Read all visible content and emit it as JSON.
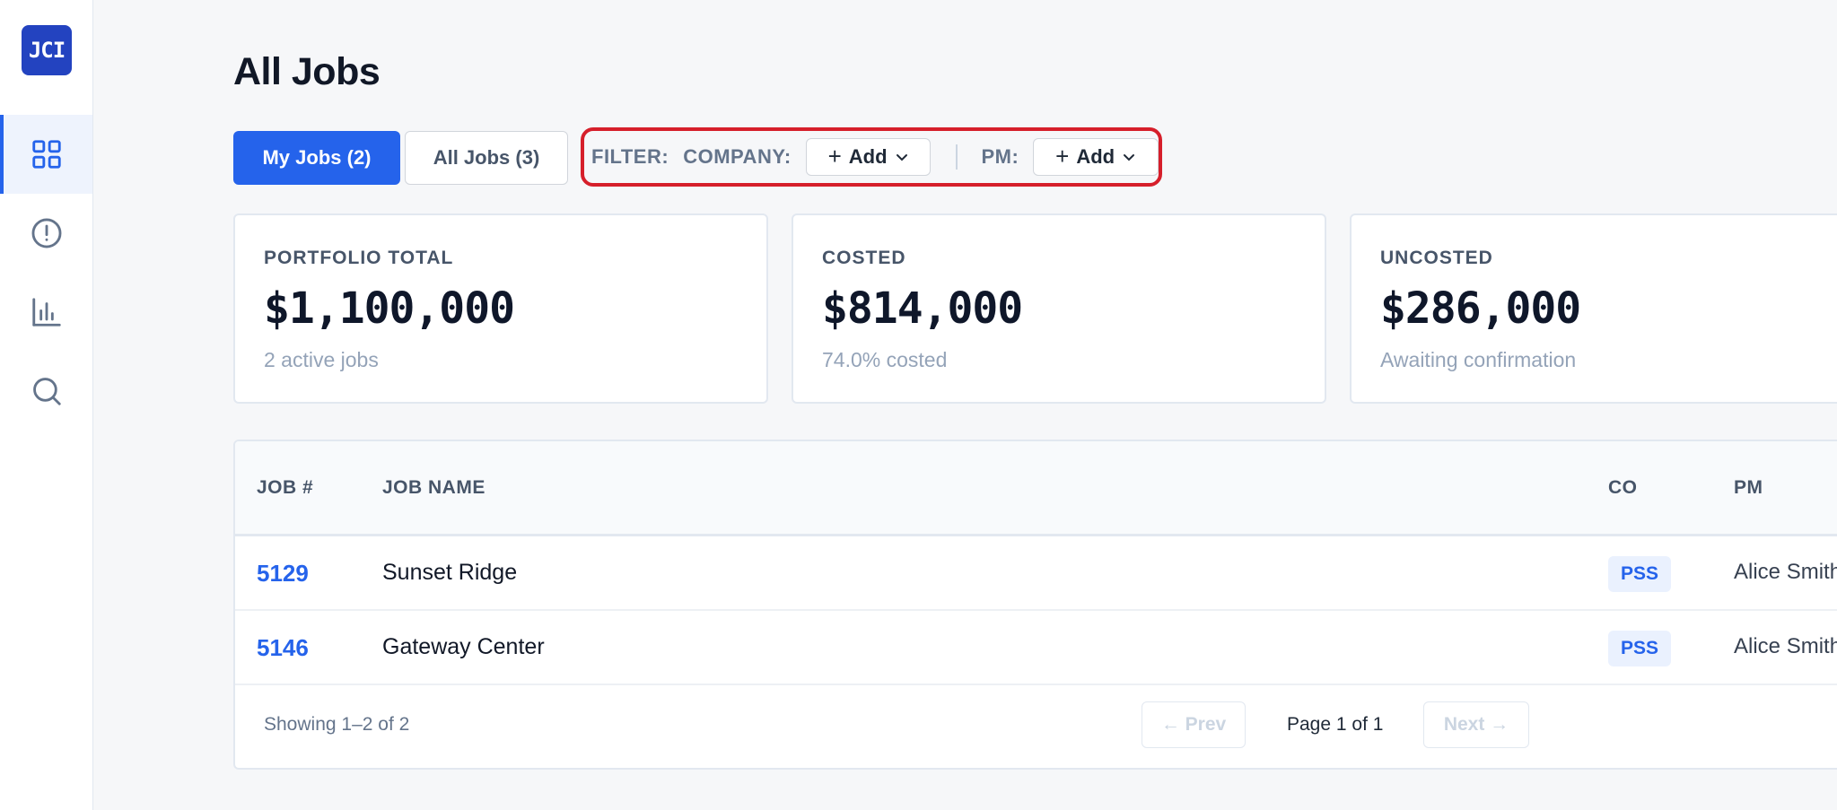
{
  "logo": {
    "text": "JCI"
  },
  "nav": [
    {
      "icon": "grid-icon",
      "active": true
    },
    {
      "icon": "alert-circle-icon",
      "active": false
    },
    {
      "icon": "bar-chart-icon",
      "active": false
    },
    {
      "icon": "search-icon",
      "active": false
    }
  ],
  "page": {
    "title": "All Jobs"
  },
  "tabs": {
    "my_jobs": "My Jobs (2)",
    "all_jobs": "All Jobs (3)"
  },
  "filter": {
    "label": "FILTER:",
    "company_label": "COMPANY:",
    "company_add": "Add",
    "pm_label": "PM:",
    "pm_add": "Add",
    "highlight_color": "#d61f2b"
  },
  "cards": [
    {
      "label": "PORTFOLIO TOTAL",
      "value": "$1,100,000",
      "sub": "2 active jobs"
    },
    {
      "label": "COSTED",
      "value": "$814,000",
      "sub": "74.0% costed"
    },
    {
      "label": "UNCOSTED",
      "value": "$286,000",
      "sub": "Awaiting confirmation"
    }
  ],
  "table": {
    "headers": {
      "job_num": "JOB #",
      "job_name": "JOB NAME",
      "co": "CO",
      "pm": "PM"
    },
    "rows": [
      {
        "job_num": "5129",
        "job_name": "Sunset Ridge",
        "co": "PSS",
        "pm": "Alice Smith"
      },
      {
        "job_num": "5146",
        "job_name": "Gateway Center",
        "co": "PSS",
        "pm": "Alice Smith"
      }
    ],
    "footer": {
      "showing": "Showing 1–2 of 2",
      "prev": "← Prev",
      "page_info": "Page 1 of 1",
      "next": "Next →"
    }
  },
  "colors": {
    "accent": "#2563eb",
    "logo_bg": "#2343c0"
  }
}
